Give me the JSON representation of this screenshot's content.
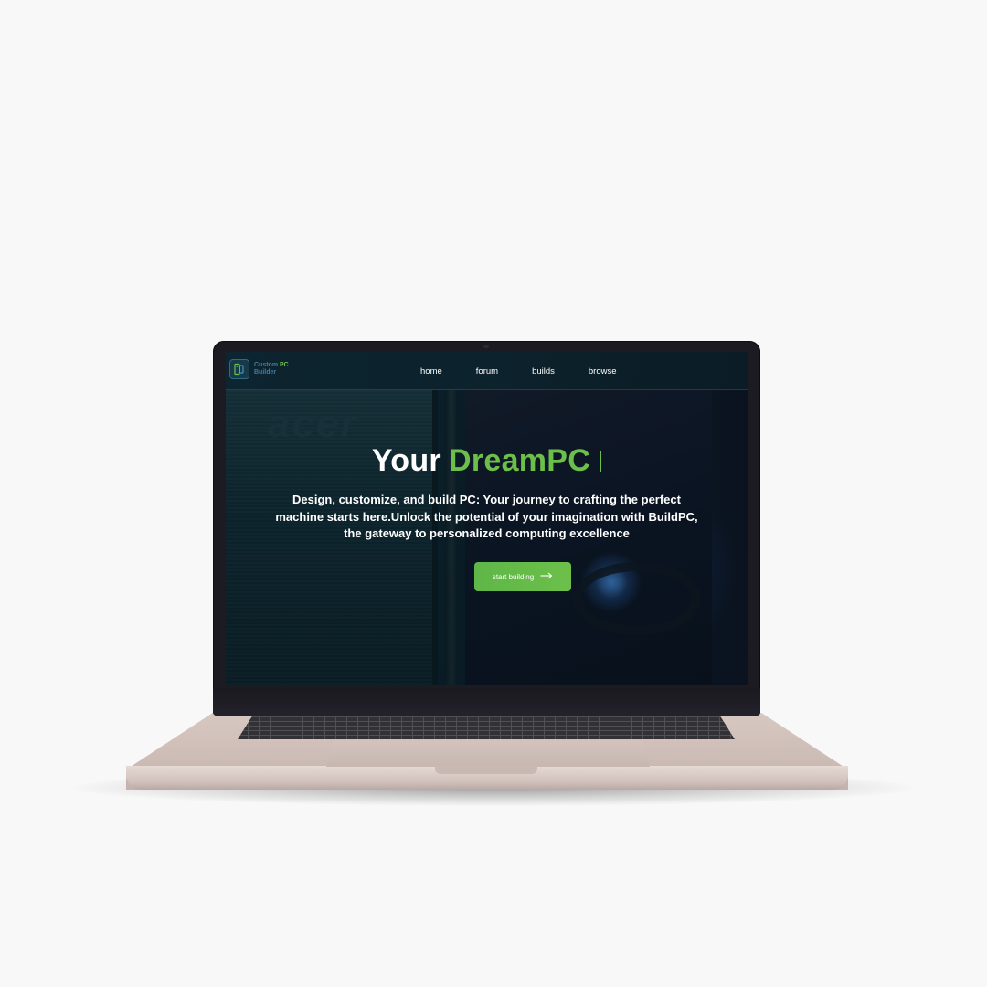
{
  "site": {
    "logo": {
      "line1": "Custom",
      "line1_accent": "PC",
      "line2": "Builder"
    },
    "nav": {
      "links": [
        "home",
        "forum",
        "builds",
        "browse"
      ]
    },
    "hero": {
      "background_brand": "acer",
      "title_prefix": "Your",
      "title_accent": "DreamPC",
      "description": "Design, customize, and build PC: Your journey to crafting the perfect machine starts here.Unlock the potential of your imagination with BuildPC, the gateway to personalized computing excellence",
      "cta_label": "start building",
      "cta_icon": "arrow-right-icon"
    }
  },
  "colors": {
    "accent": "#6cc04a",
    "nav_bg": "#0c222c",
    "logo_blue": "#3a7fa8",
    "text": "#ffffff"
  }
}
